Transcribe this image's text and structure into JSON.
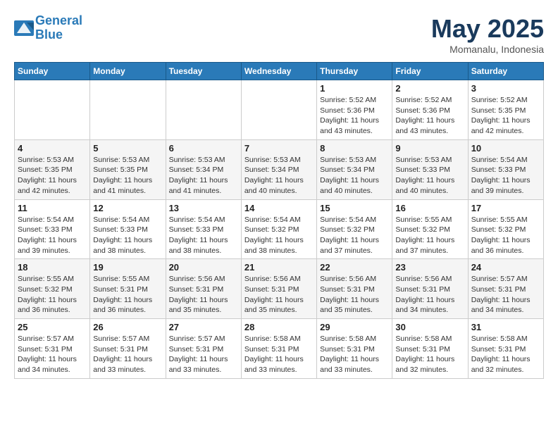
{
  "header": {
    "logo_line1": "General",
    "logo_line2": "Blue",
    "month": "May 2025",
    "location": "Momanalu, Indonesia"
  },
  "weekdays": [
    "Sunday",
    "Monday",
    "Tuesday",
    "Wednesday",
    "Thursday",
    "Friday",
    "Saturday"
  ],
  "weeks": [
    [
      {
        "day": "",
        "info": ""
      },
      {
        "day": "",
        "info": ""
      },
      {
        "day": "",
        "info": ""
      },
      {
        "day": "",
        "info": ""
      },
      {
        "day": "1",
        "info": "Sunrise: 5:52 AM\nSunset: 5:36 PM\nDaylight: 11 hours and 43 minutes."
      },
      {
        "day": "2",
        "info": "Sunrise: 5:52 AM\nSunset: 5:36 PM\nDaylight: 11 hours and 43 minutes."
      },
      {
        "day": "3",
        "info": "Sunrise: 5:52 AM\nSunset: 5:35 PM\nDaylight: 11 hours and 42 minutes."
      }
    ],
    [
      {
        "day": "4",
        "info": "Sunrise: 5:53 AM\nSunset: 5:35 PM\nDaylight: 11 hours and 42 minutes."
      },
      {
        "day": "5",
        "info": "Sunrise: 5:53 AM\nSunset: 5:35 PM\nDaylight: 11 hours and 41 minutes."
      },
      {
        "day": "6",
        "info": "Sunrise: 5:53 AM\nSunset: 5:34 PM\nDaylight: 11 hours and 41 minutes."
      },
      {
        "day": "7",
        "info": "Sunrise: 5:53 AM\nSunset: 5:34 PM\nDaylight: 11 hours and 40 minutes."
      },
      {
        "day": "8",
        "info": "Sunrise: 5:53 AM\nSunset: 5:34 PM\nDaylight: 11 hours and 40 minutes."
      },
      {
        "day": "9",
        "info": "Sunrise: 5:53 AM\nSunset: 5:33 PM\nDaylight: 11 hours and 40 minutes."
      },
      {
        "day": "10",
        "info": "Sunrise: 5:54 AM\nSunset: 5:33 PM\nDaylight: 11 hours and 39 minutes."
      }
    ],
    [
      {
        "day": "11",
        "info": "Sunrise: 5:54 AM\nSunset: 5:33 PM\nDaylight: 11 hours and 39 minutes."
      },
      {
        "day": "12",
        "info": "Sunrise: 5:54 AM\nSunset: 5:33 PM\nDaylight: 11 hours and 38 minutes."
      },
      {
        "day": "13",
        "info": "Sunrise: 5:54 AM\nSunset: 5:33 PM\nDaylight: 11 hours and 38 minutes."
      },
      {
        "day": "14",
        "info": "Sunrise: 5:54 AM\nSunset: 5:32 PM\nDaylight: 11 hours and 38 minutes."
      },
      {
        "day": "15",
        "info": "Sunrise: 5:54 AM\nSunset: 5:32 PM\nDaylight: 11 hours and 37 minutes."
      },
      {
        "day": "16",
        "info": "Sunrise: 5:55 AM\nSunset: 5:32 PM\nDaylight: 11 hours and 37 minutes."
      },
      {
        "day": "17",
        "info": "Sunrise: 5:55 AM\nSunset: 5:32 PM\nDaylight: 11 hours and 36 minutes."
      }
    ],
    [
      {
        "day": "18",
        "info": "Sunrise: 5:55 AM\nSunset: 5:32 PM\nDaylight: 11 hours and 36 minutes."
      },
      {
        "day": "19",
        "info": "Sunrise: 5:55 AM\nSunset: 5:31 PM\nDaylight: 11 hours and 36 minutes."
      },
      {
        "day": "20",
        "info": "Sunrise: 5:56 AM\nSunset: 5:31 PM\nDaylight: 11 hours and 35 minutes."
      },
      {
        "day": "21",
        "info": "Sunrise: 5:56 AM\nSunset: 5:31 PM\nDaylight: 11 hours and 35 minutes."
      },
      {
        "day": "22",
        "info": "Sunrise: 5:56 AM\nSunset: 5:31 PM\nDaylight: 11 hours and 35 minutes."
      },
      {
        "day": "23",
        "info": "Sunrise: 5:56 AM\nSunset: 5:31 PM\nDaylight: 11 hours and 34 minutes."
      },
      {
        "day": "24",
        "info": "Sunrise: 5:57 AM\nSunset: 5:31 PM\nDaylight: 11 hours and 34 minutes."
      }
    ],
    [
      {
        "day": "25",
        "info": "Sunrise: 5:57 AM\nSunset: 5:31 PM\nDaylight: 11 hours and 34 minutes."
      },
      {
        "day": "26",
        "info": "Sunrise: 5:57 AM\nSunset: 5:31 PM\nDaylight: 11 hours and 33 minutes."
      },
      {
        "day": "27",
        "info": "Sunrise: 5:57 AM\nSunset: 5:31 PM\nDaylight: 11 hours and 33 minutes."
      },
      {
        "day": "28",
        "info": "Sunrise: 5:58 AM\nSunset: 5:31 PM\nDaylight: 11 hours and 33 minutes."
      },
      {
        "day": "29",
        "info": "Sunrise: 5:58 AM\nSunset: 5:31 PM\nDaylight: 11 hours and 33 minutes."
      },
      {
        "day": "30",
        "info": "Sunrise: 5:58 AM\nSunset: 5:31 PM\nDaylight: 11 hours and 32 minutes."
      },
      {
        "day": "31",
        "info": "Sunrise: 5:58 AM\nSunset: 5:31 PM\nDaylight: 11 hours and 32 minutes."
      }
    ]
  ]
}
